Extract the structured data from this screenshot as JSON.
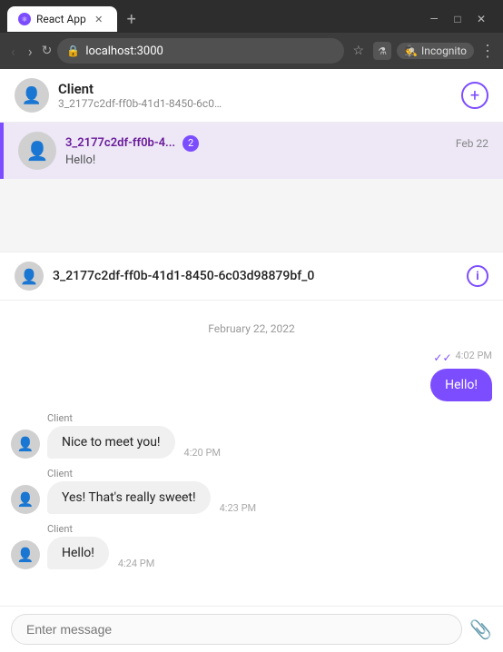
{
  "browser": {
    "tab_title": "React App",
    "tab_favicon": "⚛",
    "url_protocol": "localhost:",
    "url_host": "3000",
    "incognito_label": "Incognito",
    "menu_label": "⋮"
  },
  "sidebar": {
    "header": {
      "title": "Client",
      "subtitle": "3_2177c2df-ff0b-41d1-8450-6c03d...",
      "new_chat_icon": "+"
    },
    "conversations": [
      {
        "name": "3_2177c2df-ff0b-4...",
        "badge": "2",
        "date": "Feb 22",
        "preview": "Hello!"
      }
    ]
  },
  "chat": {
    "header_title": "3_2177c2df-ff0b-41d1-8450-6c03d98879bf_0",
    "date_divider": "February 22, 2022",
    "messages": [
      {
        "type": "outgoing",
        "text": "Hello!",
        "time": "4:02 PM",
        "checks": "✓✓"
      },
      {
        "type": "incoming",
        "sender": "Client",
        "text": "Nice to meet you!",
        "time": "4:20 PM"
      },
      {
        "type": "incoming",
        "sender": "Client",
        "text": "Yes! That's really sweet!",
        "time": "4:23 PM"
      },
      {
        "type": "incoming",
        "sender": "Client",
        "text": "Hello!",
        "time": "4:24 PM"
      }
    ],
    "input_placeholder": "Enter message"
  }
}
